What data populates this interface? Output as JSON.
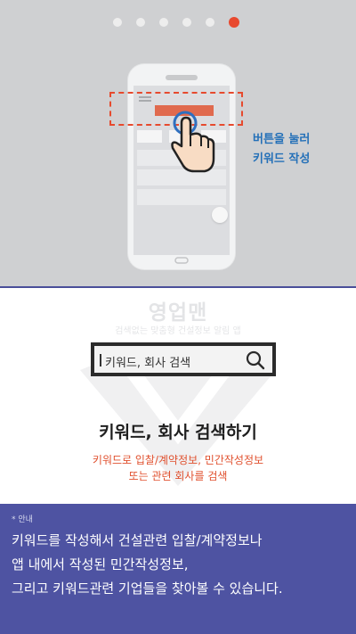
{
  "pager": {
    "total": 6,
    "active_index": 5
  },
  "illustration": {
    "hint_line1": "버튼을 눌러",
    "hint_line2": "키워드 작성"
  },
  "logo": {
    "name": "영업맨",
    "tagline": "검색없는 맞춤형 건설정보 알림 앱"
  },
  "search": {
    "value": "키워드, 회사 검색"
  },
  "heading": "키워드, 회사 검색하기",
  "description": {
    "line1": "키워드로 입찰/계약정보, 민간작성정보",
    "line2": "또는 관련 회사를 검색"
  },
  "notice": {
    "label": "* 안내",
    "text": "키워드를 작성해서 건설관련 입찰/계약정보나\n앱 내에서 작성된 민간작성정보,\n그리고 키워드관련 기업들을 찾아볼 수 있습니다."
  },
  "colors": {
    "accent": "#e8492f",
    "hint_blue": "#2470b8",
    "notice_bg": "#4e53a2",
    "hero_bg": "#cfd0d2"
  }
}
